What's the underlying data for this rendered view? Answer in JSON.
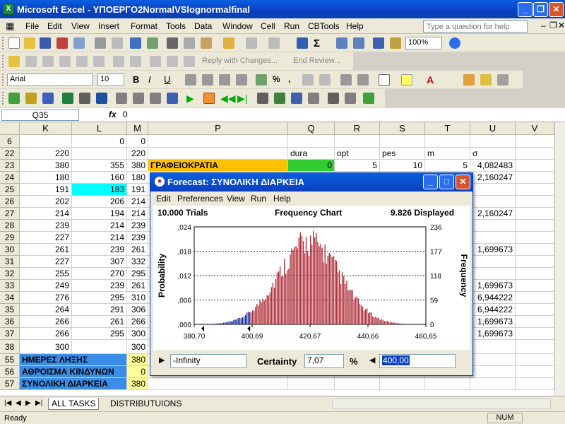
{
  "window": {
    "title": "Microsoft Excel - ΥΠΟΕΡΓΟ2NormalVSlognormalfinal"
  },
  "menu": [
    "File",
    "Edit",
    "View",
    "Insert",
    "Format",
    "Tools",
    "Data",
    "Window",
    "Cell",
    "Run",
    "CBTools",
    "Help"
  ],
  "help_box": {
    "placeholder": "Type a question for help"
  },
  "toolbar": {
    "zoom": "100%",
    "font": "Arial",
    "size": "10",
    "reply_changes": "Reply with Changes...",
    "end_review": "End Review..."
  },
  "formula_bar": {
    "cell_ref": "Q35",
    "fx": "fx",
    "value": "0"
  },
  "columns": [
    "K",
    "L",
    "M",
    "P",
    "Q",
    "R",
    "S",
    "T",
    "U",
    "V"
  ],
  "rows": [
    {
      "n": "6",
      "K": "",
      "L": "0",
      "M": "0",
      "P": "",
      "Q": "",
      "R": "",
      "S": "",
      "T": "",
      "U": ""
    },
    {
      "n": "22",
      "K": "220",
      "L": "",
      "M": "220",
      "P": "",
      "Q": "dura",
      "R": "opt",
      "S": "pes",
      "T": "m",
      "U": "σ"
    },
    {
      "n": "23",
      "K": "380",
      "L": "355",
      "M": "380",
      "P": "ΓΡΑΦΕΙΟΚΡΑΤΙΑ",
      "Q": "0",
      "R": "5",
      "S": "10",
      "T": "5",
      "U": "4,082483"
    },
    {
      "n": "24",
      "K": "180",
      "L": "160",
      "M": "180",
      "P": "",
      "Q": "",
      "R": "",
      "S": "",
      "T": "",
      "U": "2,160247"
    },
    {
      "n": "25",
      "K": "191",
      "L": "183",
      "M": "191",
      "P": "",
      "Q": "",
      "R": "",
      "S": "",
      "T": "",
      "U": ""
    },
    {
      "n": "26",
      "K": "202",
      "L": "206",
      "M": "214",
      "P": "",
      "Q": "",
      "R": "",
      "S": "",
      "T": "",
      "U": ""
    },
    {
      "n": "27",
      "K": "214",
      "L": "194",
      "M": "214",
      "P": "",
      "Q": "",
      "R": "",
      "S": "",
      "T": "",
      "U": "2,160247"
    },
    {
      "n": "28",
      "K": "239",
      "L": "214",
      "M": "239",
      "P": "",
      "Q": "",
      "R": "",
      "S": "",
      "T": "",
      "U": ""
    },
    {
      "n": "29",
      "K": "227",
      "L": "214",
      "M": "239",
      "P": "",
      "Q": "",
      "R": "",
      "S": "",
      "T": "",
      "U": ""
    },
    {
      "n": "30",
      "K": "261",
      "L": "239",
      "M": "261",
      "P": "",
      "Q": "",
      "R": "",
      "S": "",
      "T": "",
      "U": "1,699673"
    },
    {
      "n": "31",
      "K": "227",
      "L": "307",
      "M": "332",
      "P": "",
      "Q": "",
      "R": "",
      "S": "",
      "T": "",
      "U": ""
    },
    {
      "n": "32",
      "K": "255",
      "L": "270",
      "M": "295",
      "P": "",
      "Q": "",
      "R": "",
      "S": "",
      "T": "",
      "U": ""
    },
    {
      "n": "33",
      "K": "249",
      "L": "239",
      "M": "261",
      "P": "",
      "Q": "",
      "R": "",
      "S": "",
      "T": "",
      "U": "1,699673"
    },
    {
      "n": "34",
      "K": "276",
      "L": "295",
      "M": "310",
      "P": "",
      "Q": "",
      "R": "",
      "S": "",
      "T": "",
      "U": "6,944222"
    },
    {
      "n": "35",
      "K": "264",
      "L": "291",
      "M": "306",
      "P": "",
      "Q": "",
      "R": "",
      "S": "",
      "T": "",
      "U": "6,944222"
    },
    {
      "n": "36",
      "K": "266",
      "L": "261",
      "M": "266",
      "P": "",
      "Q": "",
      "R": "",
      "S": "",
      "T": "",
      "U": "1,699673"
    },
    {
      "n": "37",
      "K": "266",
      "L": "295",
      "M": "300",
      "P": "",
      "Q": "",
      "R": "",
      "S": "",
      "T": "",
      "U": "1,699673"
    },
    {
      "n": "38",
      "K": "300",
      "L": "",
      "M": "300",
      "P": "",
      "Q": "",
      "R": "",
      "S": "",
      "T": "",
      "U": ""
    },
    {
      "n": "55",
      "K": "ΗΜΕΡΕΣ ΛΗΞΗΣ",
      "L": "",
      "M": "380",
      "P": "",
      "Q": "",
      "R": "",
      "S": "",
      "T": "",
      "U": ""
    },
    {
      "n": "56",
      "K": "ΑΘΡΟΙΣΜΑ ΚΙΝΔΥΝΩΝ",
      "L": "",
      "M": "0",
      "P": "",
      "Q": "",
      "R": "",
      "S": "",
      "T": "",
      "U": ""
    },
    {
      "n": "57",
      "K": "ΣΥΝΟΛΙΚΗ ΔΙΑΡΚΕΙΑ",
      "L": "",
      "M": "380",
      "P": "",
      "Q": "",
      "R": "",
      "S": "",
      "T": "",
      "U": ""
    }
  ],
  "sheet_tabs": [
    "ALL TASKS",
    "DISTRIBUTUIONS"
  ],
  "status": {
    "left": "Ready",
    "num": "NUM"
  },
  "forecast": {
    "title": "Forecast: ΣΥΝΟΛΙΚΗ ΔΙΑΡΚΕΙΑ",
    "menu": [
      "Edit",
      "Preferences",
      "View",
      "Run",
      "Help"
    ],
    "trials": "10.000 Trials",
    "chart_title": "Frequency Chart",
    "displayed": "9.826 Displayed",
    "ylabel_left": "Probability",
    "ylabel_right": "Frequency",
    "left_ticks": [
      ",000",
      ",006",
      ",012",
      ",018",
      ",024"
    ],
    "right_ticks": [
      "0",
      "59",
      "118",
      "177",
      "236"
    ],
    "x_ticks": [
      "380,70",
      "400,69",
      "420,67",
      "440,66",
      "460,65"
    ],
    "lower": "-Infinity",
    "certainty_label": "Certainty",
    "certainty": "7,07",
    "percent": "%",
    "upper": "400,00",
    "colors": {
      "in_range": "#1a2e9e",
      "out_range": "#b0303a"
    }
  },
  "chart_data": {
    "type": "bar",
    "title": "Frequency Chart",
    "xlabel": "",
    "ylabel": "Probability",
    "xlim": [
      380.7,
      460.65
    ],
    "ylim": [
      0,
      0.024
    ],
    "peak_frequency": 236,
    "distribution": {
      "mean": 420.0,
      "std_dev": 10.5,
      "skew": 0.15
    },
    "certainty_range": [
      -1000000000.0,
      400.0
    ]
  }
}
